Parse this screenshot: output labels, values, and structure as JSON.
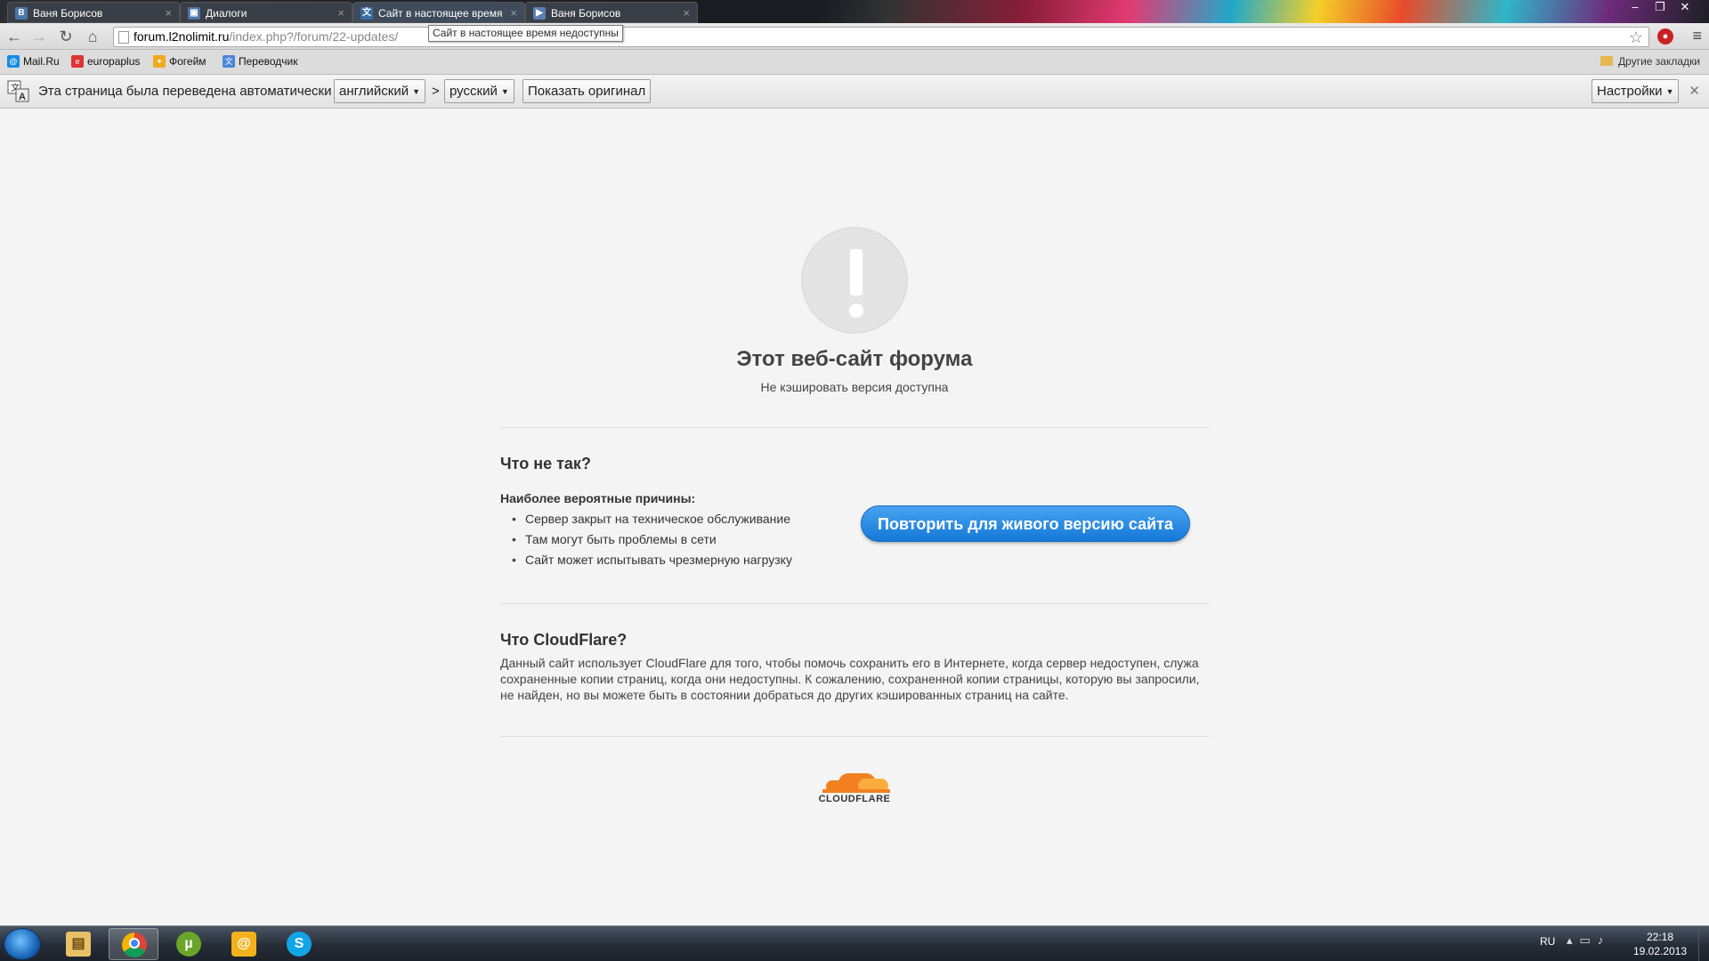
{
  "browser": {
    "tabs": [
      {
        "title": "Ваня Борисов",
        "icon": "vk-icon"
      },
      {
        "title": "Диалоги",
        "icon": "chat-icon"
      },
      {
        "title": "Сайт в настоящее время",
        "icon": "translate-icon",
        "active": true
      },
      {
        "title": "Ваня Борисов",
        "icon": "video-icon"
      }
    ],
    "tooltip": "Сайт в настоящее время недоступны",
    "url": {
      "domain": "forum.l2nolimit.ru",
      "path": "/index.php?/forum/22-updates/"
    },
    "bookmarks": [
      {
        "label": "Mail.Ru",
        "icon": "mailru-icon"
      },
      {
        "label": "europaplus",
        "icon": "europaplus-icon"
      },
      {
        "label": "Фогейм",
        "icon": "fogame-icon"
      },
      {
        "label": "Переводчик",
        "icon": "translator-icon"
      }
    ],
    "other_bookmarks": "Другие закладки",
    "translate_bar": {
      "message": "Эта страница была переведена автоматически",
      "from_lang": "английский",
      "separator": ">",
      "to_lang": "русский",
      "show_original": "Показать оригинал",
      "settings": "Настройки"
    }
  },
  "page": {
    "title": "Этот веб-сайт форума",
    "subtitle": "Не кэшировать версия доступна",
    "whats_wrong": "Что не так?",
    "causes_title": "Наиболее вероятные причины:",
    "causes": [
      "Сервер закрыт на техническое обслуживание",
      "Там могут быть проблемы в сети",
      "Сайт может испытывать чрезмерную нагрузку"
    ],
    "retry_button": "Повторить для живого версию сайта",
    "what_cf": "Что CloudFlare?",
    "cf_text": "Данный сайт использует CloudFlare для того, чтобы помочь сохранить его в Интернете, когда сервер недоступен, служа сохраненные копии страниц, когда они недоступны. К сожалению, сохраненной копии страницы, которую вы запросили, не найден, но вы можете быть в состоянии добраться до других кэшированных страниц на сайте.",
    "logo_text": "CLOUDFLARE",
    "accent_color": "#1c7fdf",
    "logo_color": "#f38020"
  },
  "taskbar": {
    "apps": [
      "explorer-icon",
      "chrome-icon",
      "utorrent-icon",
      "mailagent-icon",
      "skype-icon"
    ],
    "lang": "RU",
    "time": "22:18",
    "date": "19.02.2013"
  }
}
